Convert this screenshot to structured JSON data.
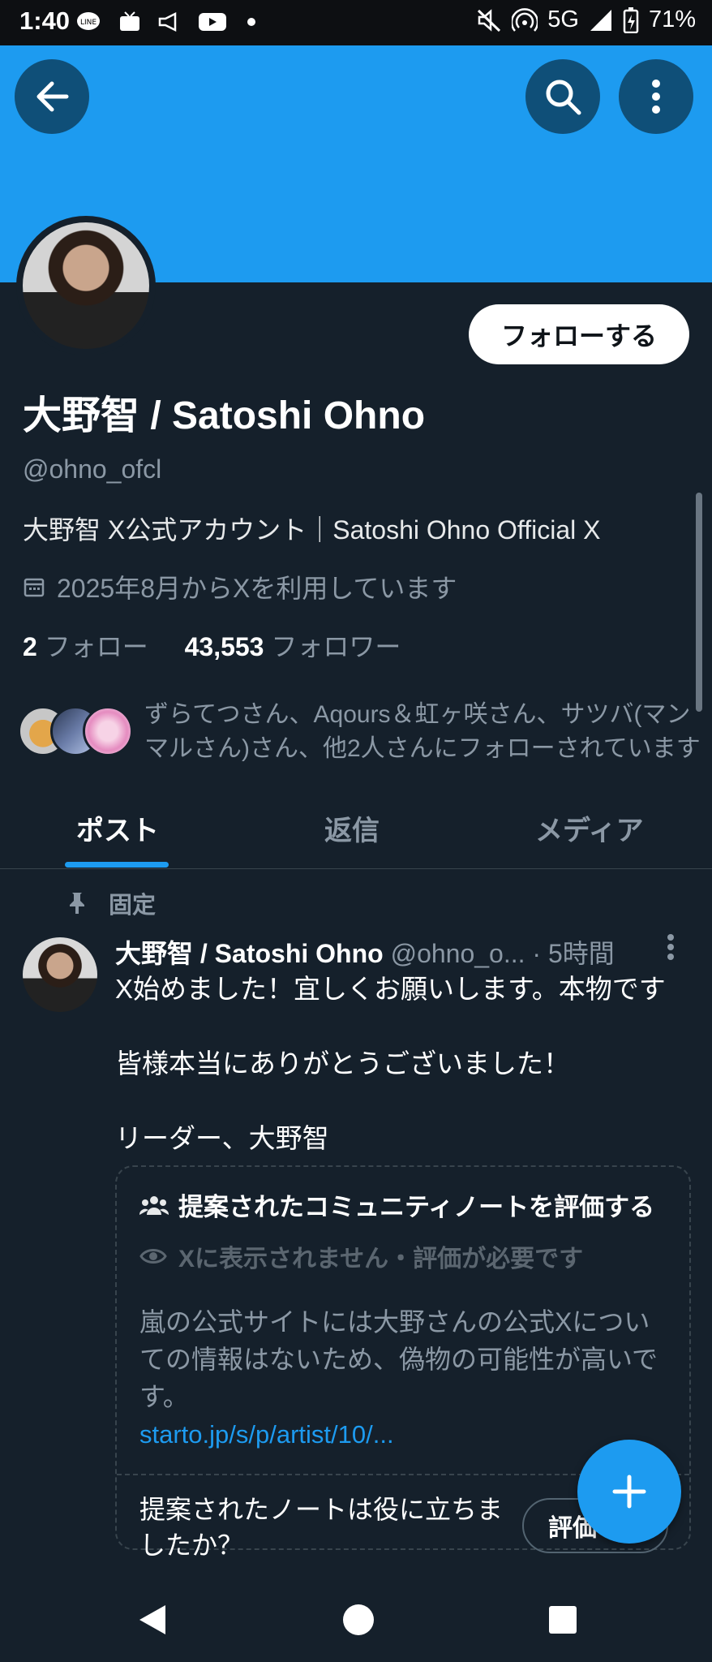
{
  "status_bar": {
    "time": "1:40",
    "network": "5G",
    "battery": "71%"
  },
  "profile": {
    "follow_label": "フォローする",
    "name": "大野智 / Satoshi Ohno",
    "handle": "@ohno_ofcl",
    "bio": "大野智  X公式アカウント｜Satoshi Ohno Official X",
    "joined": "2025年8月からXを利用しています",
    "following_count": "2",
    "following_label": "フォロー",
    "followers_count": "43,553",
    "followers_label": "フォロワー",
    "followed_by": "ずらてつさん、Aqours＆虹ヶ咲さん、サツバ(マンマルさん)さん、他2人さんにフォローされています"
  },
  "tabs": [
    {
      "label": "ポスト"
    },
    {
      "label": "返信"
    },
    {
      "label": "メディア"
    }
  ],
  "post": {
    "pinned_label": "固定",
    "author_name": "大野智 / Satoshi Ohno",
    "author_handle": "@ohno_o...",
    "time": "· 5時間",
    "lines": [
      "X始めました！宜しくお願いします。本物です",
      "",
      "皆様本当にありがとうございました！",
      "",
      "リーダー、大野智"
    ],
    "note": {
      "title": "提案されたコミュニティノートを評価する",
      "status": "Xに表示されません・評価が必要です",
      "body": "嵐の公式サイトには大野さんの公式Xについての情報はないため、偽物の可能性が高いです。",
      "link": "starto.jp/s/p/artist/10/...",
      "question": "提案されたノートは役に立ちましたか？",
      "rate_label": "評価"
    }
  },
  "colors": {
    "accent": "#1d9bf0",
    "background": "#15202b",
    "banner": "#1d9bf0"
  },
  "icons": [
    "back-arrow-icon",
    "search-icon",
    "more-vertical-icon",
    "calendar-icon",
    "pin-icon",
    "community-icon",
    "eye-icon",
    "plus-icon",
    "nav-back-icon",
    "nav-home-icon",
    "nav-recents-icon"
  ]
}
